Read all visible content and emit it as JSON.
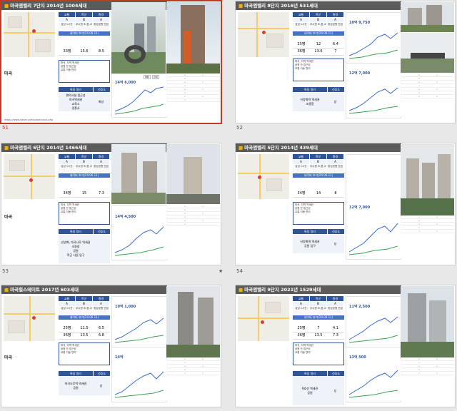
{
  "slides": [
    {
      "num": "51",
      "title": "마곡엠밸리 7단지 2014년 1004세대",
      "place": "마곡",
      "sizes": [
        [
          "33평",
          "15.6",
          "8.5"
        ]
      ],
      "price": "14억 6,000",
      "extra": "",
      "feat": [
        "편의시설 접근성",
        "마곡역세권",
        "교육소",
        "경찰서",
        "8구 판치",
        "화성"
      ],
      "footnote": "https://www.naver.com/place/xxxx.php"
    },
    {
      "num": "52",
      "title": "마곡엠밸리 8단지 2016년 531세대",
      "place": "",
      "sizes": [
        [
          "25평",
          "12",
          "6.4"
        ],
        [
          "36평",
          "13.6",
          "7"
        ]
      ],
      "price": "10억 9,750",
      "price2": "12억 7,000",
      "feat": [
        "신방화역 역세권",
        "조용함",
        "상"
      ],
      "footnote": ""
    },
    {
      "num": "53",
      "title": "마곡엠밸리 6단지 2014년 1466세대",
      "place": "마곡",
      "sizes": [
        [
          "34평",
          "15",
          "7.3"
        ]
      ],
      "price": "14억 4,500",
      "feat": [
        "신방화, 마곡나루 역세권",
        "조용함",
        "공원",
        "학군 사업 입구",
        "경찰서 조용"
      ],
      "footnote": ""
    },
    {
      "num": "54",
      "title": "마곡엠밸리 5단지 2014년 439세대",
      "place": "",
      "sizes": [
        [
          "34평",
          "14",
          "8"
        ]
      ],
      "price": "12억 7,000",
      "feat": [
        "신방화역 역세권",
        "공원 입구",
        "상"
      ],
      "footnote": ""
    },
    {
      "num": "55",
      "title": "마곡힐스테이트 2017년 603세대",
      "place": "마곡",
      "sizes": [
        [
          "25평",
          "11.5",
          "6.5"
        ],
        [
          "36평",
          "13.5",
          "6.8"
        ]
      ],
      "price": "10억 1,000",
      "price2": "14억",
      "feat": [
        "마곡나루역 역세권",
        "공원",
        "상"
      ],
      "footnote": ""
    },
    {
      "num": "56",
      "title": "마곡엠밸리 9단지 2021년 1529세대",
      "place": "",
      "sizes": [
        [
          "25평",
          "7",
          "4.1"
        ],
        [
          "36평",
          "13.5",
          "7.3"
        ]
      ],
      "price": "11억 2,500",
      "price2": "13억 500",
      "feat": [
        "9호선 역세권",
        "공원",
        "상"
      ],
      "footnote": ""
    }
  ],
  "common": {
    "hd": [
      "교통",
      "학군",
      "환경"
    ],
    "grade": [
      "A",
      "B",
      "A"
    ],
    "distance": [
      "강남 1시간",
      "우수한 초,중,고",
      "한강공원 인접"
    ],
    "link_label": "네이버 호가(24.06.11)",
    "feat_head": [
      "특징 정리",
      "선호도"
    ],
    "size_head": [
      "평형",
      "매매가",
      "전세가"
    ],
    "sale_tab": "매매",
    "lease_tab": "전세",
    "chart_prefix": "매매",
    "star_glyph": "★",
    "desc_lines": [
      "마곡, 지역 역세권",
      "공원 안 접근성",
      "교통 이동 편리"
    ]
  },
  "colors": {
    "accent": "#2f5597",
    "title_bg": "#5b5b5b",
    "selected": "#c0392b"
  }
}
